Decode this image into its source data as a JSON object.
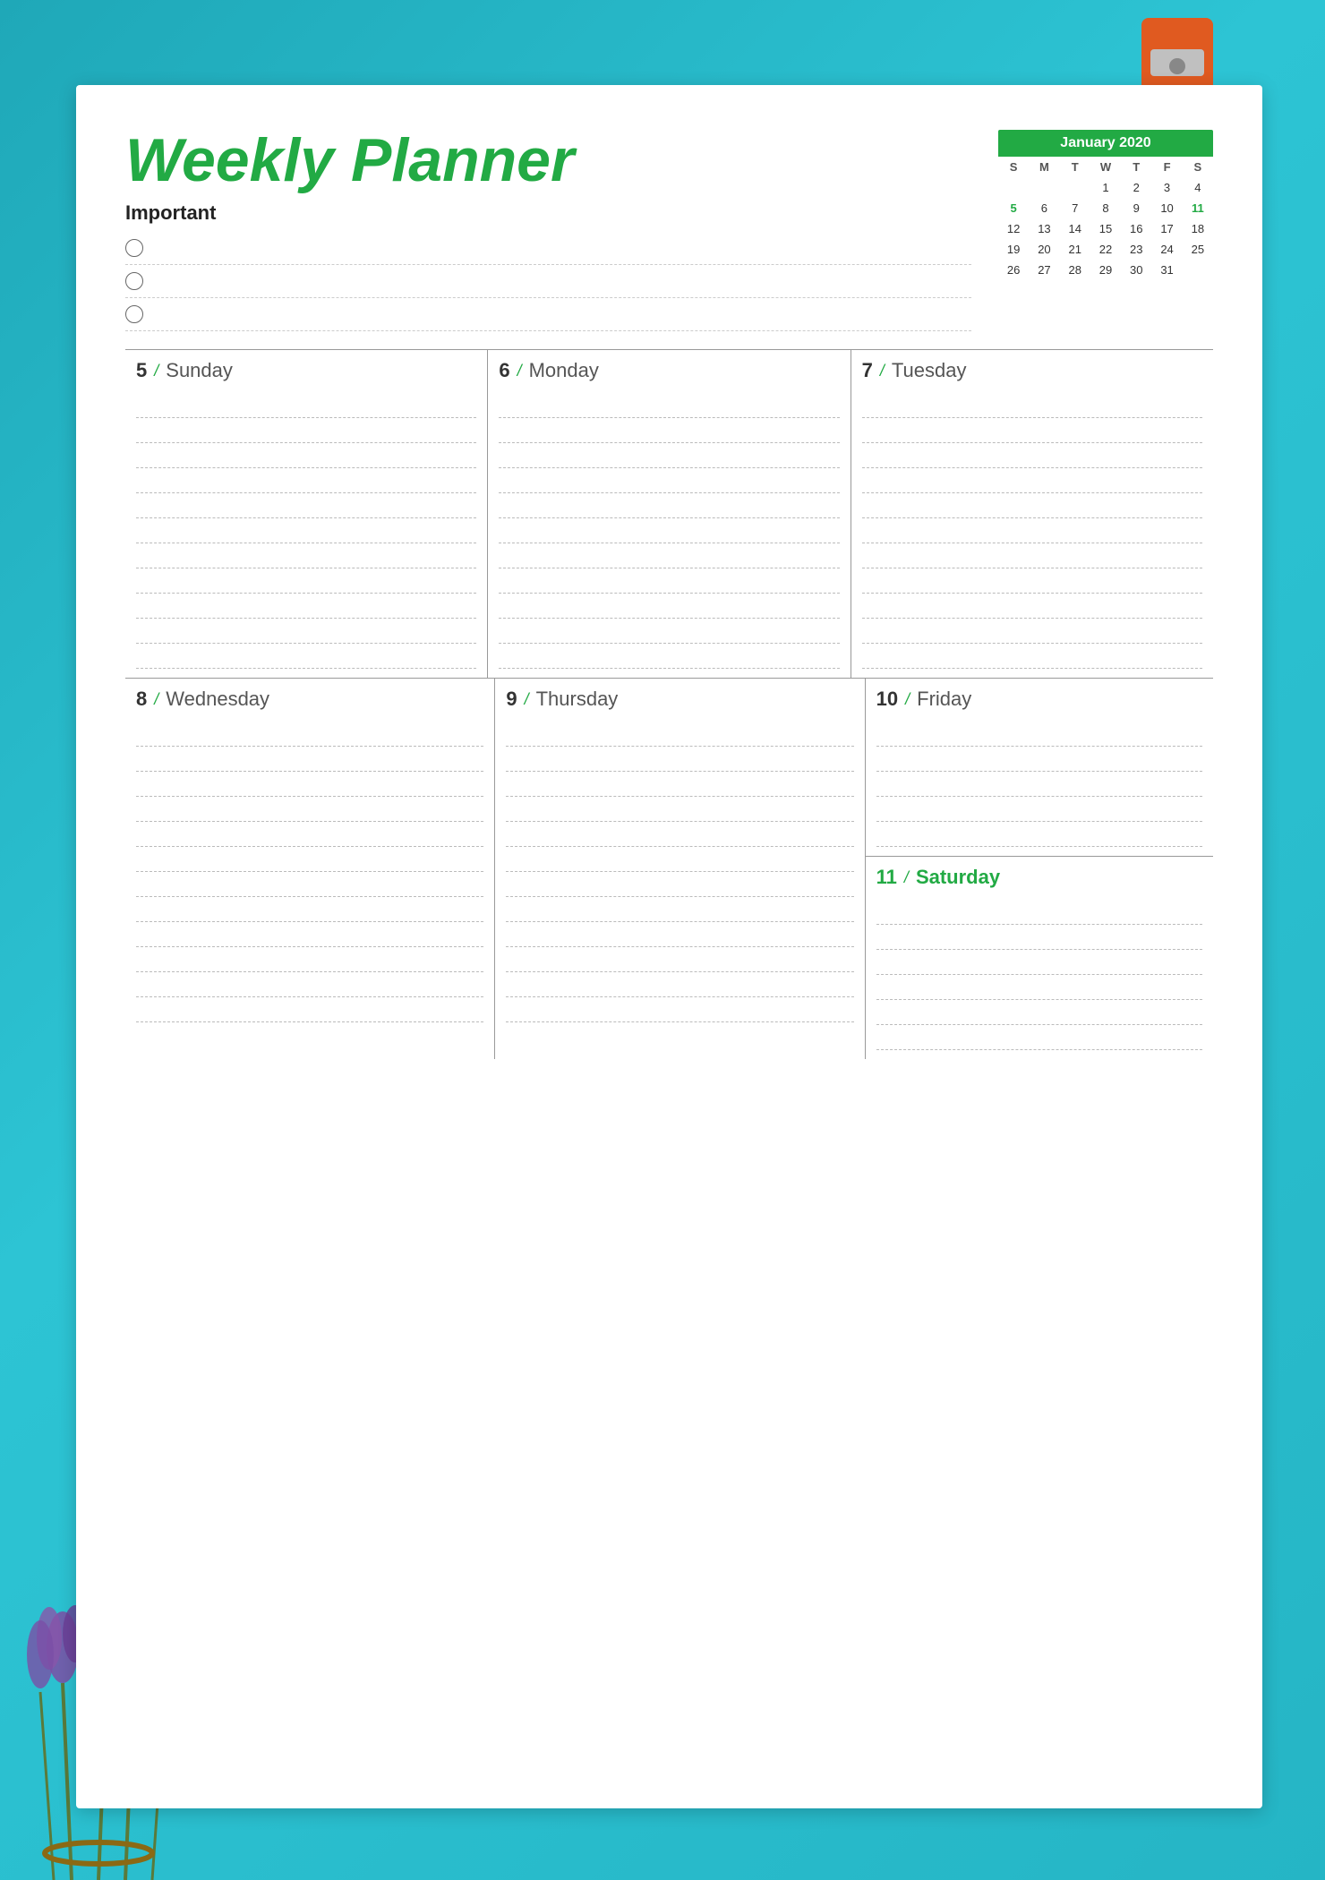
{
  "title": "Weekly Planner",
  "important_label": "Important",
  "important_items": [
    "",
    "",
    ""
  ],
  "calendar": {
    "header": "January 2020",
    "days_of_week": [
      "S",
      "M",
      "T",
      "W",
      "T",
      "F",
      "S"
    ],
    "weeks": [
      [
        "",
        "",
        "",
        "1",
        "2",
        "3",
        "4"
      ],
      [
        "5",
        "6",
        "7",
        "8",
        "9",
        "10",
        "11"
      ],
      [
        "12",
        "13",
        "14",
        "15",
        "16",
        "17",
        "18"
      ],
      [
        "19",
        "20",
        "21",
        "22",
        "23",
        "24",
        "25"
      ],
      [
        "26",
        "27",
        "28",
        "29",
        "30",
        "31",
        ""
      ]
    ]
  },
  "week_row1": [
    {
      "num": "5",
      "name": "Sunday"
    },
    {
      "num": "6",
      "name": "Monday"
    },
    {
      "num": "7",
      "name": "Tuesday"
    }
  ],
  "week_row2": [
    {
      "num": "8",
      "name": "Wednesday"
    },
    {
      "num": "9",
      "name": "Thursday"
    },
    {
      "num": "10",
      "name": "Friday",
      "split": true
    },
    {
      "num": "11",
      "name": "Saturday",
      "green": true
    }
  ],
  "lines_per_day": 10,
  "colors": {
    "green": "#22aa44",
    "teal_bg": "#2ab8c8"
  }
}
